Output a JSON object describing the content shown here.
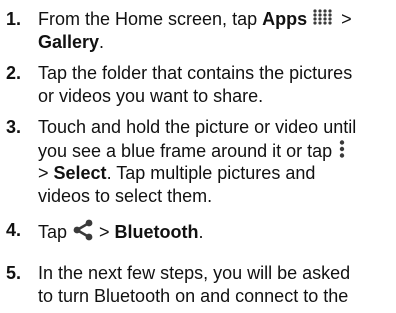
{
  "steps": [
    {
      "number": "1.",
      "line1": {
        "pre": "From the Home screen, tap ",
        "bold": "Apps",
        "post": " >"
      },
      "line2": {
        "bold": "Gallery",
        "post": "."
      },
      "icon": "apps-grid-icon"
    },
    {
      "number": "2.",
      "line1": "Tap the folder that contains the pictures",
      "line2": "or videos you want to share."
    },
    {
      "number": "3.",
      "line1": "Touch and hold the picture or video until",
      "line2": "you see a blue frame around it or tap",
      "line3": {
        "pre": "> ",
        "bold": "Select",
        "post": ". Tap multiple pictures and"
      },
      "line4": "videos to select them.",
      "icon": "more-options-icon"
    },
    {
      "number": "4.",
      "line1": {
        "pre": "Tap ",
        "mid": " > ",
        "bold": "Bluetooth",
        "post": "."
      },
      "icon": "share-icon"
    },
    {
      "number": "5.",
      "line1": "In the next few steps, you will be asked",
      "line2": "to turn Bluetooth on and connect to the"
    }
  ],
  "colors": {
    "text": "#111111",
    "icon": "#3a3a3a"
  }
}
